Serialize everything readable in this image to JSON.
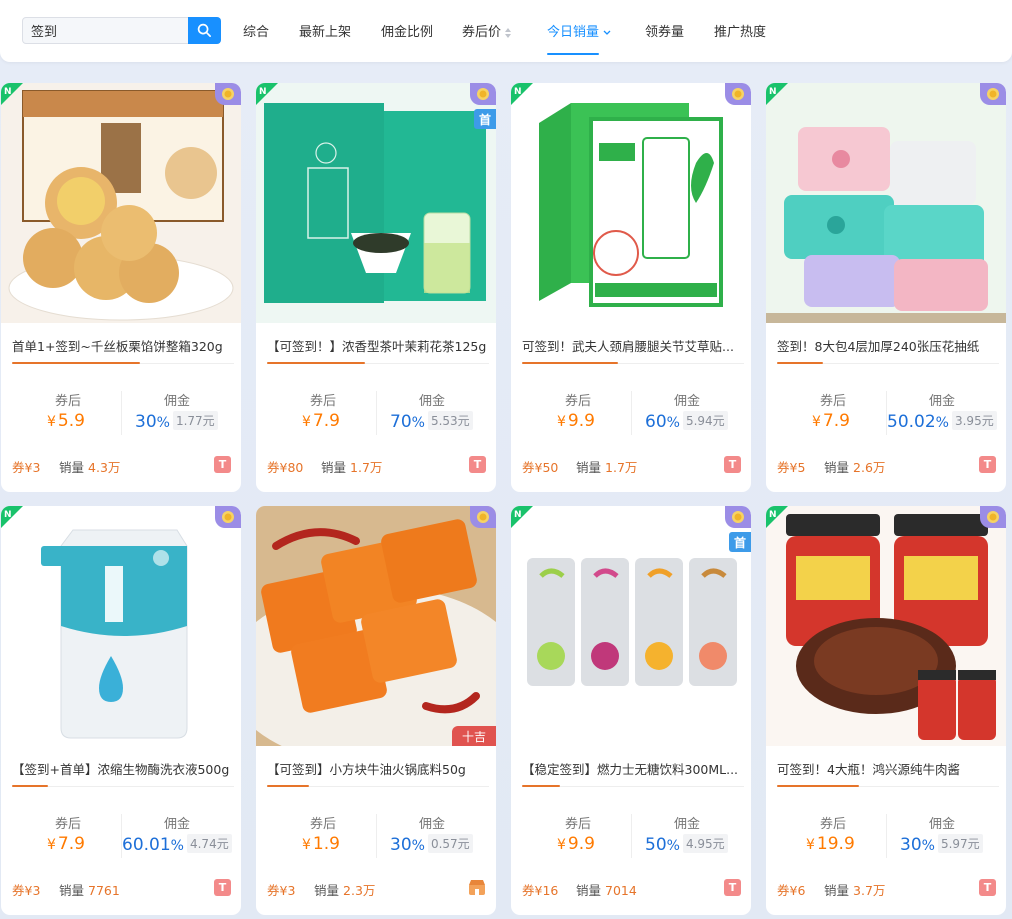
{
  "search": {
    "value": "签到"
  },
  "tabs": [
    {
      "label": "综合"
    },
    {
      "label": "最新上架"
    },
    {
      "label": "佣金比例"
    },
    {
      "label": "券后价"
    },
    {
      "label": "今日销量"
    },
    {
      "label": "领券量"
    },
    {
      "label": "推广热度"
    }
  ],
  "active_tab": "今日销量",
  "labels": {
    "after_coupon": "券后",
    "commission": "佣金",
    "sales": "销量",
    "yen": "¥",
    "pct": "%"
  },
  "badges": {
    "first": "首",
    "shijie": "十吉",
    "n": "N",
    "t": "T"
  },
  "colors": {
    "accent_blue": "#1890ff",
    "price_orange": "#ff7a00",
    "commission_blue": "#1d6fd8",
    "crown_purple": "#9b8de6",
    "n_green": "#19c26b"
  },
  "products": [
    {
      "title": "首单1+签到~千丝板栗馅饼整箱320g",
      "price": "5.9",
      "commission_pct": "30",
      "commission_amt": "1.77元",
      "coupon": "券¥3",
      "sales": "4.3万",
      "image": "chestnut-pastry",
      "first_badge": false
    },
    {
      "title": "【可签到！】浓香型茶叶茉莉花茶125g",
      "price": "7.9",
      "commission_pct": "70",
      "commission_amt": "5.53元",
      "coupon": "券¥80",
      "sales": "1.7万",
      "image": "jasmine-tea",
      "first_badge": true
    },
    {
      "title": "可签到！武夫人颈肩腰腿关节艾草贴...",
      "price": "9.9",
      "commission_pct": "60",
      "commission_amt": "5.94元",
      "coupon": "券¥50",
      "sales": "1.7万",
      "image": "mugwort-patch",
      "first_badge": false
    },
    {
      "title": "签到！8大包4层加厚240张压花抽纸",
      "price": "7.9",
      "commission_pct": "50.02",
      "commission_amt": "3.95元",
      "coupon": "券¥5",
      "sales": "2.6万",
      "image": "tissue-packs",
      "first_badge": false
    },
    {
      "title": "【签到+首单】浓缩生物酶洗衣液500g",
      "price": "7.9",
      "commission_pct": "60.01",
      "commission_amt": "4.74元",
      "coupon": "券¥3",
      "sales": "7761",
      "image": "detergent-refill",
      "first_badge": false
    },
    {
      "title": "【可签到】小方块牛油火锅底料50g",
      "price": "1.9",
      "commission_pct": "30",
      "commission_amt": "0.57元",
      "coupon": "券¥3",
      "sales": "2.3万",
      "image": "hotpot-base",
      "first_badge": false
    },
    {
      "title": "【稳定签到】燃力士无糖饮料300ML...",
      "price": "9.9",
      "commission_pct": "50",
      "commission_amt": "4.95元",
      "coupon": "券¥16",
      "sales": "7014",
      "image": "celsius-cans",
      "first_badge": true
    },
    {
      "title": "可签到！4大瓶！鸿兴源纯牛肉酱",
      "price": "19.9",
      "commission_pct": "30",
      "commission_amt": "5.97元",
      "coupon": "券¥6",
      "sales": "3.7万",
      "image": "beef-sauce",
      "first_badge": false
    }
  ]
}
